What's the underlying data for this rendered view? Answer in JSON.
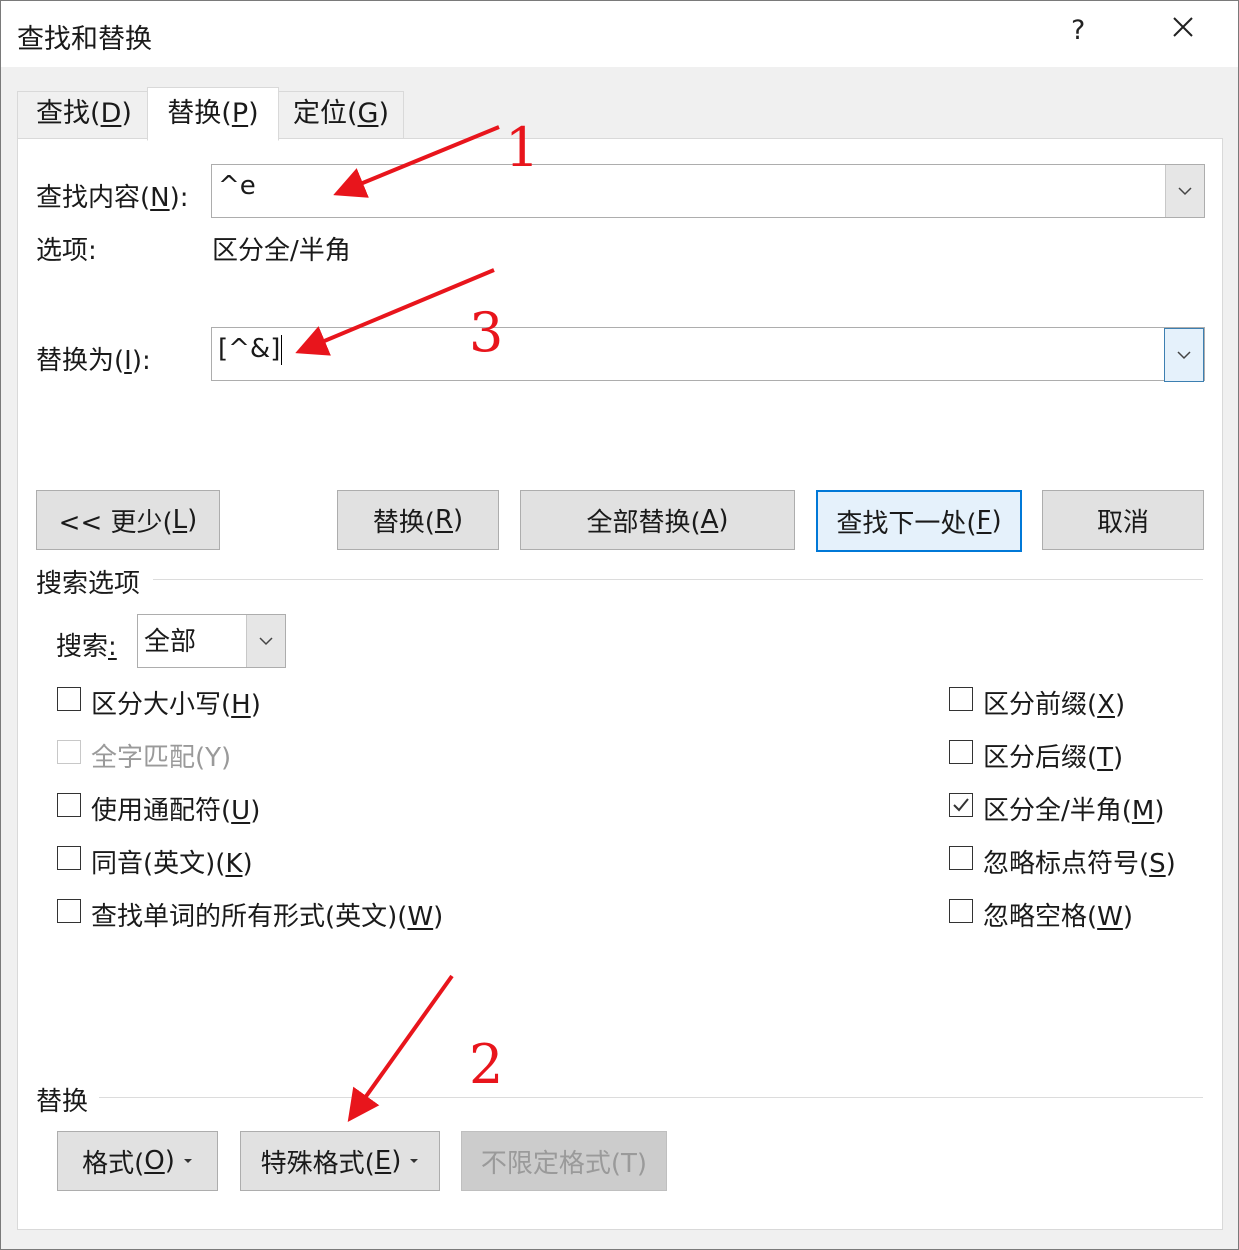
{
  "window": {
    "title": "查找和替换",
    "help": "?",
    "close": "✕"
  },
  "tabs": [
    {
      "label": "查找(",
      "key": "D",
      "tail": ")"
    },
    {
      "label": "替换(",
      "key": "P",
      "tail": ")"
    },
    {
      "label": "定位(",
      "key": "G",
      "tail": ")"
    }
  ],
  "find": {
    "label": "查找内容(",
    "key": "N",
    "tail": "):",
    "value": "^e"
  },
  "options": {
    "label": "选项:",
    "value": "区分全/半角"
  },
  "replace": {
    "label": "替换为(",
    "key": "I",
    "tail": "):",
    "value": "[^&]"
  },
  "buttons": {
    "less": {
      "label": "<< 更少(",
      "key": "L",
      "tail": ")"
    },
    "replace": {
      "label": "替换(",
      "key": "R",
      "tail": ")"
    },
    "replace_all": {
      "label": "全部替换(",
      "key": "A",
      "tail": ")"
    },
    "find_next": {
      "label": "查找下一处(",
      "key": "F",
      "tail": ")"
    },
    "cancel": {
      "label": "取消"
    }
  },
  "search_options": {
    "heading": "搜索选项",
    "search_label": "搜索",
    "search_colon": ":",
    "search_value": "全部",
    "left": [
      {
        "label": "区分大小写(",
        "key": "H",
        "tail": ")",
        "checked": false,
        "disabled": false
      },
      {
        "label": "全字匹配(Y)",
        "key": "",
        "tail": "",
        "checked": false,
        "disabled": true
      },
      {
        "label": "使用通配符(",
        "key": "U",
        "tail": ")",
        "checked": false,
        "disabled": false
      },
      {
        "label": "同音(英文)(",
        "key": "K",
        "tail": ")",
        "checked": false,
        "disabled": false
      },
      {
        "label": "查找单词的所有形式(英文)(",
        "key": "W",
        "tail": ")",
        "checked": false,
        "disabled": false
      }
    ],
    "right": [
      {
        "label": "区分前缀(",
        "key": "X",
        "tail": ")",
        "checked": false
      },
      {
        "label": "区分后缀(",
        "key": "T",
        "tail": ")",
        "checked": false
      },
      {
        "label": "区分全/半角(",
        "key": "M",
        "tail": ")",
        "checked": true
      },
      {
        "label": "忽略标点符号(",
        "key": "S",
        "tail": ")",
        "checked": false
      },
      {
        "label": "忽略空格(",
        "key": "W",
        "tail": ")",
        "checked": false
      }
    ]
  },
  "replace_section": {
    "heading": "替换",
    "format": {
      "label": "格式(",
      "key": "O",
      "tail": ")"
    },
    "special": {
      "label": "特殊格式(",
      "key": "E",
      "tail": ")"
    },
    "no_format": {
      "label": "不限定格式(T)"
    }
  },
  "annotations": {
    "one": "1",
    "two": "2",
    "three": "3"
  },
  "colors": {
    "annotation": "#e8151c",
    "focus": "#0078d7"
  }
}
